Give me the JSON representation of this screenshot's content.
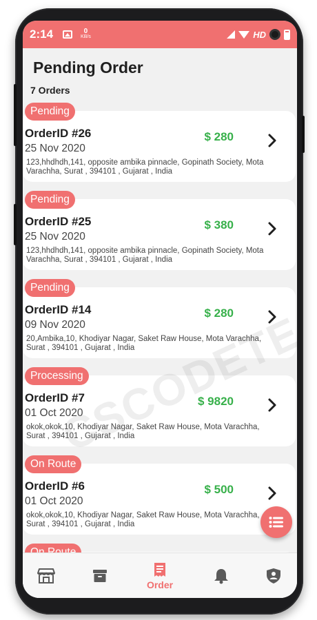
{
  "status_bar": {
    "time": "2:14",
    "kbs_value": "0",
    "kbs_unit": "KB/s",
    "network_label": "HD"
  },
  "page": {
    "title": "Pending Order",
    "count_label": "7 Orders"
  },
  "orders": [
    {
      "status": "Pending",
      "id_label": "OrderID #26",
      "date": "25 Nov 2020",
      "price": "$ 280",
      "address": "123,hhdhdh,141, opposite ambika pinnacle, Gopinath Society, Mota Varachha,  Surat , 394101 , Gujarat , India"
    },
    {
      "status": "Pending",
      "id_label": "OrderID #25",
      "date": "25 Nov 2020",
      "price": "$ 380",
      "address": "123,hhdhdh,141, opposite ambika pinnacle, Gopinath Society, Mota Varachha,  Surat , 394101 , Gujarat , India"
    },
    {
      "status": "Pending",
      "id_label": "OrderID #14",
      "date": "09 Nov 2020",
      "price": "$ 280",
      "address": "20,Ambika,10, Khodiyar Nagar, Saket Raw House, Mota Varachha,  Surat , 394101 , Gujarat , India"
    },
    {
      "status": "Processing",
      "id_label": "OrderID #7",
      "date": "01 Oct 2020",
      "price": "$ 9820",
      "address": "okok,okok,10, Khodiyar Nagar, Saket Raw House, Mota Varachha, Surat , 394101 , Gujarat , India"
    },
    {
      "status": "On Route",
      "id_label": "OrderID #6",
      "date": "01 Oct 2020",
      "price": "$ 500",
      "address": "okok,okok,10, Khodiyar Nagar, Saket Raw House, Mota Varachha, Surat , 394101 , Gujarat , India"
    },
    {
      "status": "On Route",
      "id_label": "",
      "date": "",
      "price": "",
      "address": ""
    }
  ],
  "bottom_nav": {
    "items": [
      {
        "icon": "store-icon",
        "label": ""
      },
      {
        "icon": "archive-box-icon",
        "label": ""
      },
      {
        "icon": "order-list-icon",
        "label": "Order"
      },
      {
        "icon": "bell-icon",
        "label": ""
      },
      {
        "icon": "user-shield-icon",
        "label": ""
      }
    ]
  },
  "watermark": "CSCODETECH",
  "colors": {
    "accent": "#f07070",
    "price_green": "#37b04a",
    "background": "#f1f1f1"
  }
}
